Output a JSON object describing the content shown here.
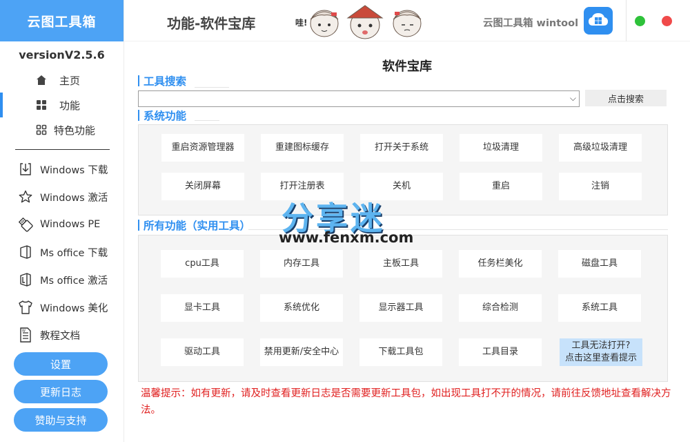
{
  "sidebar": {
    "brand": "云图工具箱",
    "version": "versionV2.5.6",
    "nav": [
      {
        "label": "主页",
        "icon": "home-icon"
      },
      {
        "label": "功能",
        "icon": "grid-icon"
      },
      {
        "label": "特色功能",
        "icon": "apps-icon"
      }
    ],
    "tools": [
      {
        "label": "Windows 下载",
        "icon": "download-icon"
      },
      {
        "label": "Windows 激活",
        "icon": "star-icon"
      },
      {
        "label": "Windows PE",
        "icon": "usb-drive-icon"
      },
      {
        "label": "Ms office 下载",
        "icon": "office-icon"
      },
      {
        "label": "Ms office 激活",
        "icon": "office-activate-icon"
      },
      {
        "label": "Windows 美化",
        "icon": "tshirt-icon"
      },
      {
        "label": "教程文档",
        "icon": "document-icon"
      }
    ],
    "buttons": {
      "settings": "设置",
      "changelog": "更新日志",
      "sponsor": "赞助与支持"
    }
  },
  "topbar": {
    "page_title": "功能-软件宝库",
    "app_name": "云图工具箱 wintool",
    "mascot_text": "哇!"
  },
  "main": {
    "title": "软件宝库",
    "search_section": "工具搜索",
    "search_button": "点击搜索",
    "system_section": "系统功能",
    "system_buttons": [
      "重启资源管理器",
      "重建图标缓存",
      "打开关于系统",
      "垃圾清理",
      "高级垃圾清理",
      "关闭屏幕",
      "打开注册表",
      "关机",
      "重启",
      "注销"
    ],
    "all_section": "所有功能（实用工具）",
    "all_buttons": [
      "cpu工具",
      "内存工具",
      "主板工具",
      "任务栏美化",
      "磁盘工具",
      "显卡工具",
      "系统优化",
      "显示器工具",
      "综合检测",
      "系统工具",
      "驱动工具",
      "禁用更新/安全中心",
      "下载工具包",
      "工具目录"
    ],
    "hint_line1": "工具无法打开?",
    "hint_line2": "点击这里查看提示",
    "notice": "温馨提示：如有更新，请及时查看更新日志是否需要更新工具包，如出现工具打不开的情况，请前往反馈地址查看解决方法。"
  },
  "watermark": {
    "text": "分享迷",
    "url": "www.fenxm.com"
  },
  "colors": {
    "accent": "#4da3f5",
    "section": "#2f8ff0",
    "notice": "#e02020",
    "close": "#f04a4a",
    "maximize": "#2ec23a"
  }
}
